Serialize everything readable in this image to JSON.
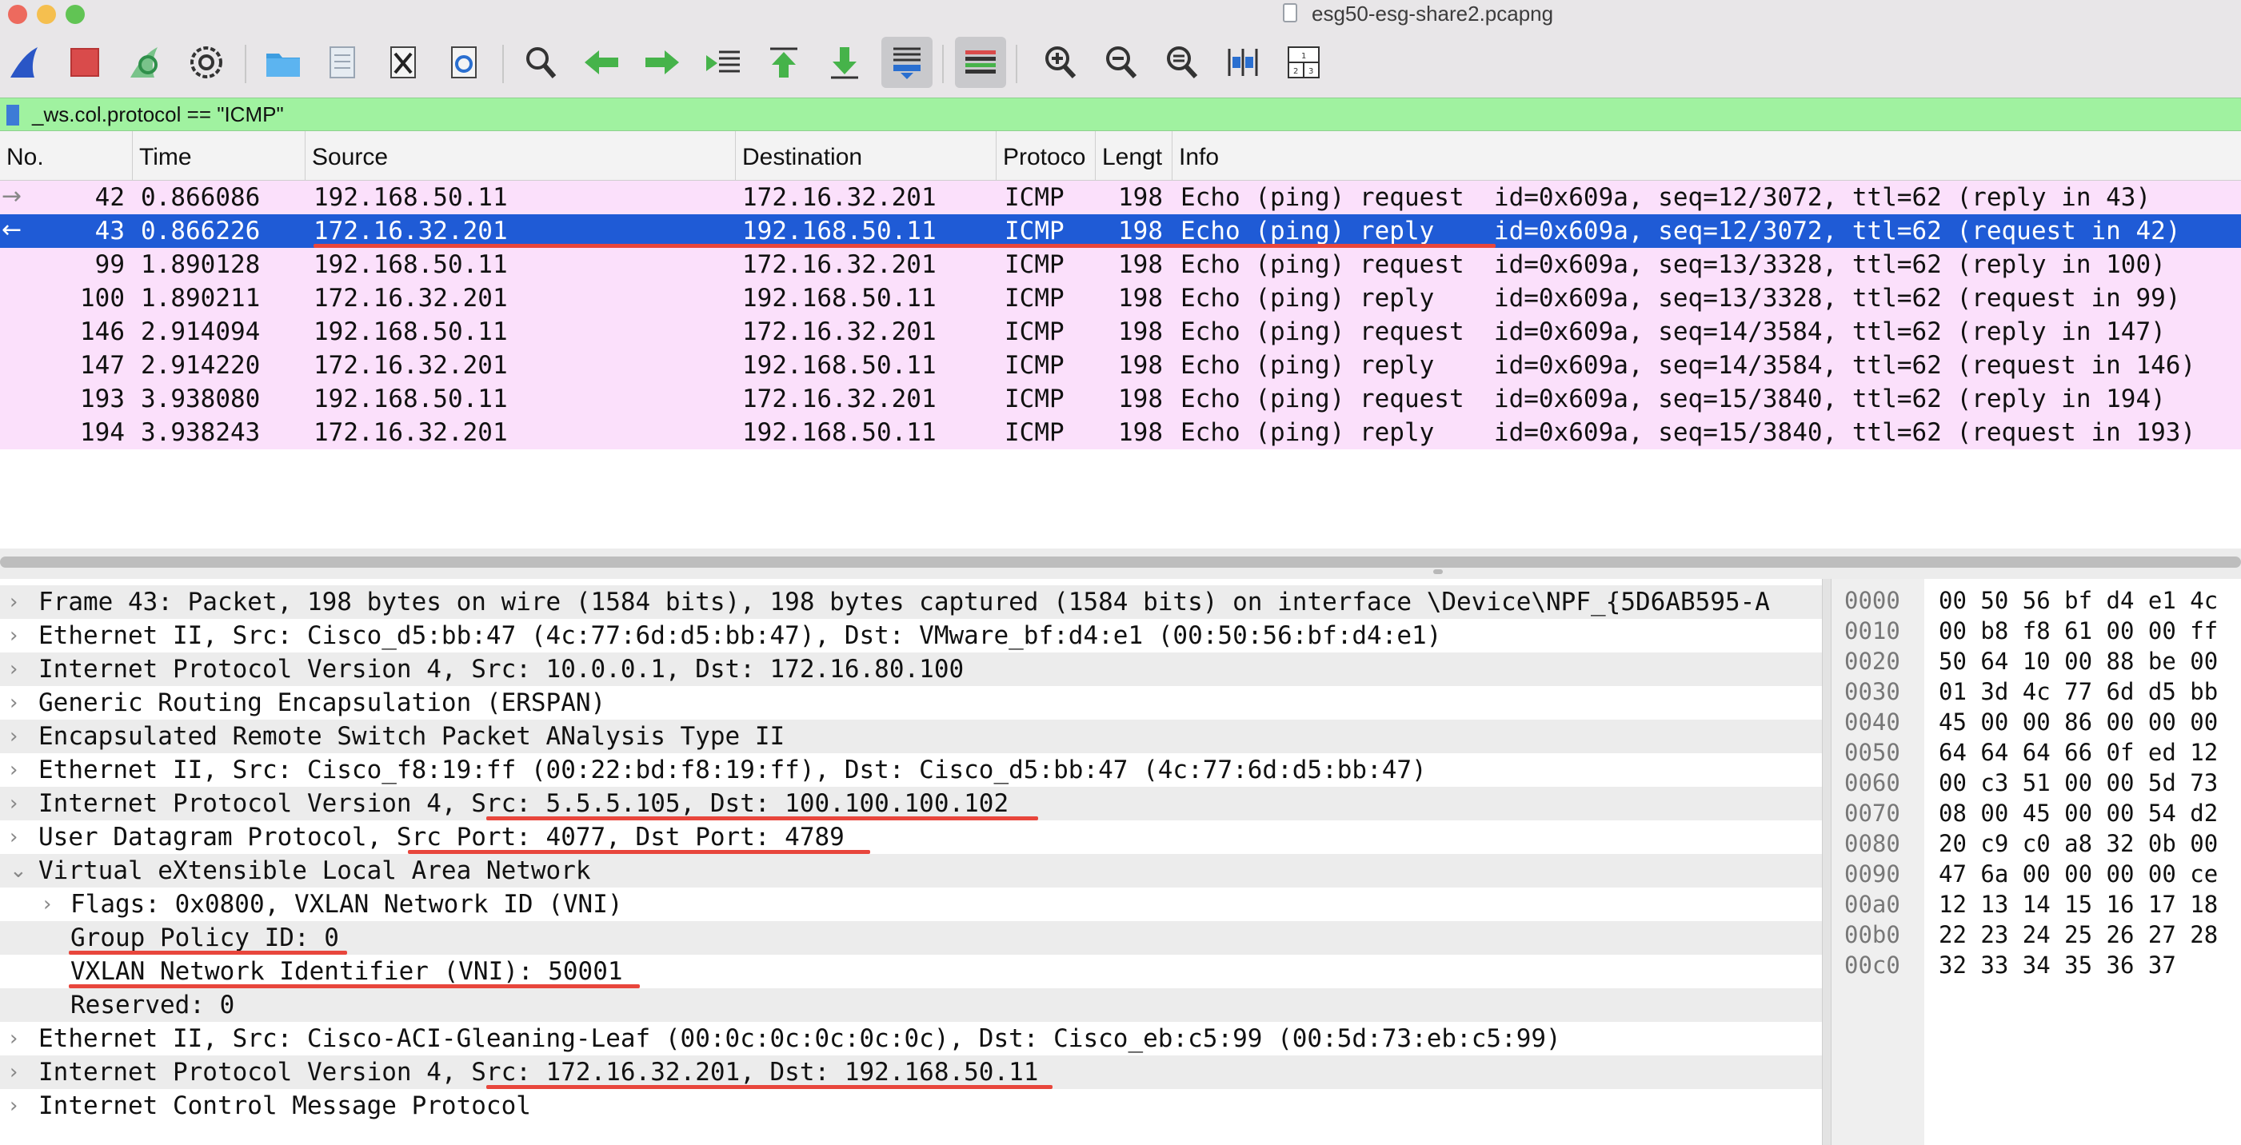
{
  "window": {
    "title": "esg50-esg-share2.pcapng"
  },
  "filter": {
    "value": "_ws.col.protocol == \"ICMP\""
  },
  "columns": [
    "No.",
    "Time",
    "Source",
    "Destination",
    "Protoco",
    "Lengt",
    "Info"
  ],
  "packets": [
    {
      "no": "42",
      "time": "0.866086",
      "source": "192.168.50.11",
      "destination": "172.16.32.201",
      "protocol": "ICMP",
      "length": "198",
      "info": "Echo (ping) request  id=0x609a, seq=12/3072, ttl=62 (reply in 43)",
      "arrow": "→"
    },
    {
      "no": "43",
      "time": "0.866226",
      "source": "172.16.32.201",
      "destination": "192.168.50.11",
      "protocol": "ICMP",
      "length": "198",
      "info": "Echo (ping) reply    id=0x609a, seq=12/3072, ttl=62 (request in 42)",
      "arrow": "←"
    },
    {
      "no": "99",
      "time": "1.890128",
      "source": "192.168.50.11",
      "destination": "172.16.32.201",
      "protocol": "ICMP",
      "length": "198",
      "info": "Echo (ping) request  id=0x609a, seq=13/3328, ttl=62 (reply in 100)",
      "arrow": ""
    },
    {
      "no": "100",
      "time": "1.890211",
      "source": "172.16.32.201",
      "destination": "192.168.50.11",
      "protocol": "ICMP",
      "length": "198",
      "info": "Echo (ping) reply    id=0x609a, seq=13/3328, ttl=62 (request in 99)",
      "arrow": ""
    },
    {
      "no": "146",
      "time": "2.914094",
      "source": "192.168.50.11",
      "destination": "172.16.32.201",
      "protocol": "ICMP",
      "length": "198",
      "info": "Echo (ping) request  id=0x609a, seq=14/3584, ttl=62 (reply in 147)",
      "arrow": ""
    },
    {
      "no": "147",
      "time": "2.914220",
      "source": "172.16.32.201",
      "destination": "192.168.50.11",
      "protocol": "ICMP",
      "length": "198",
      "info": "Echo (ping) reply    id=0x609a, seq=14/3584, ttl=62 (request in 146)",
      "arrow": ""
    },
    {
      "no": "193",
      "time": "3.938080",
      "source": "192.168.50.11",
      "destination": "172.16.32.201",
      "protocol": "ICMP",
      "length": "198",
      "info": "Echo (ping) request  id=0x609a, seq=15/3840, ttl=62 (reply in 194)",
      "arrow": ""
    },
    {
      "no": "194",
      "time": "3.938243",
      "source": "172.16.32.201",
      "destination": "192.168.50.11",
      "protocol": "ICMP",
      "length": "198",
      "info": "Echo (ping) reply    id=0x609a, seq=15/3840, ttl=62 (request in 193)",
      "arrow": ""
    }
  ],
  "details": [
    {
      "text": "Frame 43: Packet, 198 bytes on wire (1584 bits), 198 bytes captured (1584 bits) on interface \\Device\\NPF_{5D6AB595-A",
      "chevron": "›"
    },
    {
      "text": "Ethernet II, Src: Cisco_d5:bb:47 (4c:77:6d:d5:bb:47), Dst: VMware_bf:d4:e1 (00:50:56:bf:d4:e1)",
      "chevron": "›"
    },
    {
      "text": "Internet Protocol Version 4, Src: 10.0.0.1, Dst: 172.16.80.100",
      "chevron": "›"
    },
    {
      "text": "Generic Routing Encapsulation (ERSPAN)",
      "chevron": "›"
    },
    {
      "text": "Encapsulated Remote Switch Packet ANalysis Type II",
      "chevron": "›"
    },
    {
      "text": "Ethernet II, Src: Cisco_f8:19:ff (00:22:bd:f8:19:ff), Dst: Cisco_d5:bb:47 (4c:77:6d:d5:bb:47)",
      "chevron": "›"
    },
    {
      "text": "Internet Protocol Version 4, Src: 5.5.5.105, Dst: 100.100.100.102",
      "chevron": "›"
    },
    {
      "text": "User Datagram Protocol, Src Port: 4077, Dst Port: 4789",
      "chevron": "›"
    },
    {
      "text": "Virtual eXtensible Local Area Network",
      "chevron": "⌄"
    },
    {
      "text": "Flags: 0x0800, VXLAN Network ID (VNI)",
      "chevron": "›"
    },
    {
      "text": "Group Policy ID: 0",
      "chevron": ""
    },
    {
      "text": "VXLAN Network Identifier (VNI): 50001",
      "chevron": ""
    },
    {
      "text": "Reserved: 0",
      "chevron": ""
    },
    {
      "text": "Ethernet II, Src: Cisco-ACI-Gleaning-Leaf (00:0c:0c:0c:0c:0c), Dst: Cisco_eb:c5:99 (00:5d:73:eb:c5:99)",
      "chevron": "›"
    },
    {
      "text": "Internet Protocol Version 4, Src: 172.16.32.201, Dst: 192.168.50.11",
      "chevron": "›"
    },
    {
      "text": "Internet Control Message Protocol",
      "chevron": "›"
    }
  ],
  "hex": [
    {
      "offset": "0000",
      "bytes": "00 50 56 bf d4 e1 4c"
    },
    {
      "offset": "0010",
      "bytes": "00 b8 f8 61 00 00 ff"
    },
    {
      "offset": "0020",
      "bytes": "50 64 10 00 88 be 00"
    },
    {
      "offset": "0030",
      "bytes": "01 3d 4c 77 6d d5 bb"
    },
    {
      "offset": "0040",
      "bytes": "45 00 00 86 00 00 00"
    },
    {
      "offset": "0050",
      "bytes": "64 64 64 66 0f ed 12"
    },
    {
      "offset": "0060",
      "bytes": "00 c3 51 00 00 5d 73"
    },
    {
      "offset": "0070",
      "bytes": "08 00 45 00 00 54 d2"
    },
    {
      "offset": "0080",
      "bytes": "20 c9 c0 a8 32 0b 00"
    },
    {
      "offset": "0090",
      "bytes": "47 6a 00 00 00 00 ce"
    },
    {
      "offset": "00a0",
      "bytes": "12 13 14 15 16 17 18"
    },
    {
      "offset": "00b0",
      "bytes": "22 23 24 25 26 27 28"
    },
    {
      "offset": "00c0",
      "bytes": "32 33 34 35 36 37"
    }
  ],
  "toolbar_icons": [
    "shark-fin-icon",
    "stop-icon",
    "restart-icon",
    "capture-options-icon",
    "open-folder-icon",
    "file-icon",
    "close-file-icon",
    "reload-icon",
    "search-icon",
    "back-arrow-icon",
    "forward-arrow-icon",
    "go-to-packet-icon",
    "first-packet-icon",
    "last-packet-icon",
    "autoscroll-icon",
    "colorize-icon",
    "zoom-in-icon",
    "zoom-out-icon",
    "normal-size-icon",
    "resize-columns-icon",
    "layout-icon"
  ],
  "colors": {
    "filter_bg": "#a0f2a0",
    "icmp_row_bg": "#fbe0fb",
    "selected_row_bg": "#1f5bd6",
    "annotation_underline": "#e8463c"
  }
}
